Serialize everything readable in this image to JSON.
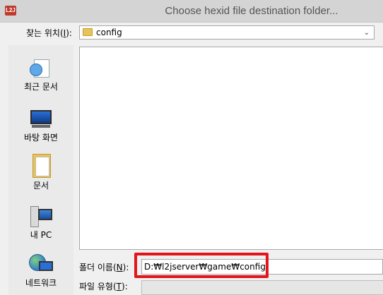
{
  "window": {
    "title": "Choose hexid file destination folder...",
    "app_icon_text": "L2J"
  },
  "lookin": {
    "label_pre": "찾는 위치(",
    "label_key": "I",
    "label_post": "):",
    "value": "config"
  },
  "places": [
    {
      "label": "최근 문서",
      "icon": "recent-documents-icon"
    },
    {
      "label": "바탕 화면",
      "icon": "desktop-icon"
    },
    {
      "label": "문서",
      "icon": "documents-icon"
    },
    {
      "label": "내 PC",
      "icon": "my-pc-icon"
    },
    {
      "label": "네트워크",
      "icon": "network-icon"
    }
  ],
  "folder_name": {
    "label_pre": "폴더 이름(",
    "label_key": "N",
    "label_post": "):",
    "value": "D:₩l2jserver₩game₩config"
  },
  "file_type": {
    "label_pre": "파일 유형(",
    "label_key": "T",
    "label_post": "):",
    "value": ""
  },
  "colors": {
    "highlight": "#e4141b",
    "titlebar": "#d4d4d4"
  }
}
